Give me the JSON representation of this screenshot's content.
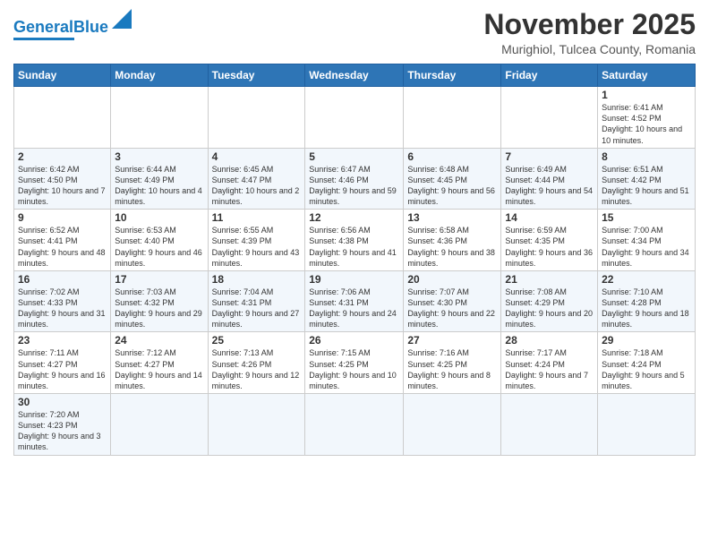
{
  "header": {
    "logo_general": "General",
    "logo_blue": "Blue",
    "month_title": "November 2025",
    "location": "Murighiol, Tulcea County, Romania"
  },
  "days_of_week": [
    "Sunday",
    "Monday",
    "Tuesday",
    "Wednesday",
    "Thursday",
    "Friday",
    "Saturday"
  ],
  "weeks": [
    {
      "cells": [
        {
          "day": "",
          "info": ""
        },
        {
          "day": "",
          "info": ""
        },
        {
          "day": "",
          "info": ""
        },
        {
          "day": "",
          "info": ""
        },
        {
          "day": "",
          "info": ""
        },
        {
          "day": "",
          "info": ""
        },
        {
          "day": "1",
          "info": "Sunrise: 6:41 AM\nSunset: 4:52 PM\nDaylight: 10 hours and 10 minutes."
        }
      ]
    },
    {
      "cells": [
        {
          "day": "2",
          "info": "Sunrise: 6:42 AM\nSunset: 4:50 PM\nDaylight: 10 hours and 7 minutes."
        },
        {
          "day": "3",
          "info": "Sunrise: 6:44 AM\nSunset: 4:49 PM\nDaylight: 10 hours and 4 minutes."
        },
        {
          "day": "4",
          "info": "Sunrise: 6:45 AM\nSunset: 4:47 PM\nDaylight: 10 hours and 2 minutes."
        },
        {
          "day": "5",
          "info": "Sunrise: 6:47 AM\nSunset: 4:46 PM\nDaylight: 9 hours and 59 minutes."
        },
        {
          "day": "6",
          "info": "Sunrise: 6:48 AM\nSunset: 4:45 PM\nDaylight: 9 hours and 56 minutes."
        },
        {
          "day": "7",
          "info": "Sunrise: 6:49 AM\nSunset: 4:44 PM\nDaylight: 9 hours and 54 minutes."
        },
        {
          "day": "8",
          "info": "Sunrise: 6:51 AM\nSunset: 4:42 PM\nDaylight: 9 hours and 51 minutes."
        }
      ]
    },
    {
      "cells": [
        {
          "day": "9",
          "info": "Sunrise: 6:52 AM\nSunset: 4:41 PM\nDaylight: 9 hours and 48 minutes."
        },
        {
          "day": "10",
          "info": "Sunrise: 6:53 AM\nSunset: 4:40 PM\nDaylight: 9 hours and 46 minutes."
        },
        {
          "day": "11",
          "info": "Sunrise: 6:55 AM\nSunset: 4:39 PM\nDaylight: 9 hours and 43 minutes."
        },
        {
          "day": "12",
          "info": "Sunrise: 6:56 AM\nSunset: 4:38 PM\nDaylight: 9 hours and 41 minutes."
        },
        {
          "day": "13",
          "info": "Sunrise: 6:58 AM\nSunset: 4:36 PM\nDaylight: 9 hours and 38 minutes."
        },
        {
          "day": "14",
          "info": "Sunrise: 6:59 AM\nSunset: 4:35 PM\nDaylight: 9 hours and 36 minutes."
        },
        {
          "day": "15",
          "info": "Sunrise: 7:00 AM\nSunset: 4:34 PM\nDaylight: 9 hours and 34 minutes."
        }
      ]
    },
    {
      "cells": [
        {
          "day": "16",
          "info": "Sunrise: 7:02 AM\nSunset: 4:33 PM\nDaylight: 9 hours and 31 minutes."
        },
        {
          "day": "17",
          "info": "Sunrise: 7:03 AM\nSunset: 4:32 PM\nDaylight: 9 hours and 29 minutes."
        },
        {
          "day": "18",
          "info": "Sunrise: 7:04 AM\nSunset: 4:31 PM\nDaylight: 9 hours and 27 minutes."
        },
        {
          "day": "19",
          "info": "Sunrise: 7:06 AM\nSunset: 4:31 PM\nDaylight: 9 hours and 24 minutes."
        },
        {
          "day": "20",
          "info": "Sunrise: 7:07 AM\nSunset: 4:30 PM\nDaylight: 9 hours and 22 minutes."
        },
        {
          "day": "21",
          "info": "Sunrise: 7:08 AM\nSunset: 4:29 PM\nDaylight: 9 hours and 20 minutes."
        },
        {
          "day": "22",
          "info": "Sunrise: 7:10 AM\nSunset: 4:28 PM\nDaylight: 9 hours and 18 minutes."
        }
      ]
    },
    {
      "cells": [
        {
          "day": "23",
          "info": "Sunrise: 7:11 AM\nSunset: 4:27 PM\nDaylight: 9 hours and 16 minutes."
        },
        {
          "day": "24",
          "info": "Sunrise: 7:12 AM\nSunset: 4:27 PM\nDaylight: 9 hours and 14 minutes."
        },
        {
          "day": "25",
          "info": "Sunrise: 7:13 AM\nSunset: 4:26 PM\nDaylight: 9 hours and 12 minutes."
        },
        {
          "day": "26",
          "info": "Sunrise: 7:15 AM\nSunset: 4:25 PM\nDaylight: 9 hours and 10 minutes."
        },
        {
          "day": "27",
          "info": "Sunrise: 7:16 AM\nSunset: 4:25 PM\nDaylight: 9 hours and 8 minutes."
        },
        {
          "day": "28",
          "info": "Sunrise: 7:17 AM\nSunset: 4:24 PM\nDaylight: 9 hours and 7 minutes."
        },
        {
          "day": "29",
          "info": "Sunrise: 7:18 AM\nSunset: 4:24 PM\nDaylight: 9 hours and 5 minutes."
        }
      ]
    },
    {
      "cells": [
        {
          "day": "30",
          "info": "Sunrise: 7:20 AM\nSunset: 4:23 PM\nDaylight: 9 hours and 3 minutes."
        },
        {
          "day": "",
          "info": ""
        },
        {
          "day": "",
          "info": ""
        },
        {
          "day": "",
          "info": ""
        },
        {
          "day": "",
          "info": ""
        },
        {
          "day": "",
          "info": ""
        },
        {
          "day": "",
          "info": ""
        }
      ]
    }
  ]
}
